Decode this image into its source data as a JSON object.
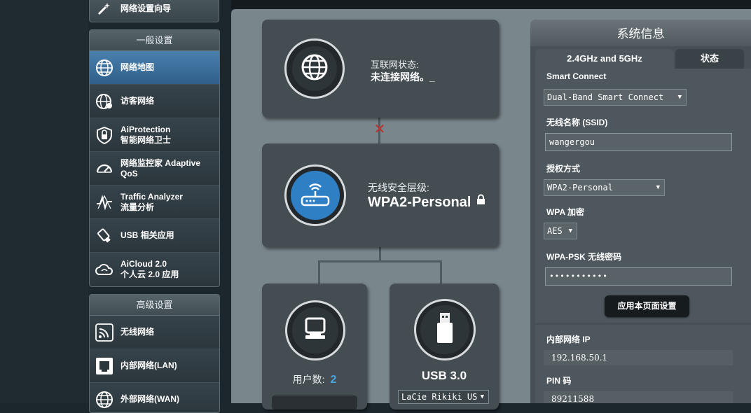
{
  "sidebar": {
    "top_item": {
      "label": "网络设置向导"
    },
    "general": {
      "header": "一般设置",
      "items": [
        {
          "label": "网络地图",
          "icon": "globe-icon",
          "active": true
        },
        {
          "label": "访客网络",
          "icon": "guest-network-icon"
        },
        {
          "label": "AiProtection\n智能网络卫士",
          "icon": "shield-icon"
        },
        {
          "label": "网络监控家 Adaptive\nQoS",
          "icon": "speedometer-icon"
        },
        {
          "label": "Traffic Analyzer\n流量分析",
          "icon": "traffic-analyzer-icon"
        },
        {
          "label": "USB 相关应用",
          "icon": "usb-apps-icon"
        },
        {
          "label": "AiCloud 2.0\n个人云 2.0 应用",
          "icon": "cloud-icon"
        }
      ]
    },
    "advanced": {
      "header": "高级设置",
      "items": [
        {
          "label": "无线网络",
          "icon": "wireless-icon"
        },
        {
          "label": "内部网络(LAN)",
          "icon": "lan-icon"
        },
        {
          "label": "外部网络(WAN)",
          "icon": "wan-globe-icon"
        }
      ]
    }
  },
  "network_map": {
    "internet": {
      "status_label": "互联网状态:",
      "status_value": "未连接网络。_"
    },
    "router": {
      "security_label": "无线安全层级:",
      "security_value": "WPA2-Personal"
    },
    "clients": {
      "label": "用户数:",
      "count": "2"
    },
    "usb": {
      "title": "USB 3.0",
      "device": "LaCie Rikiki US"
    },
    "colors": {
      "disconnected": "#c0312b",
      "accent_blue": "#4aa6e0"
    }
  },
  "system_info": {
    "title": "系统信息",
    "tabs": {
      "active": "2.4GHz and 5GHz",
      "other": "状态"
    },
    "smart_connect": {
      "label": "Smart Connect",
      "value": "Dual-Band Smart Connect"
    },
    "ssid": {
      "label": "无线名称 (SSID)",
      "value": "wangergou"
    },
    "auth": {
      "label": "授权方式",
      "value": "WPA2-Personal"
    },
    "wpa_encryption": {
      "label": "WPA 加密",
      "value": "AES"
    },
    "wpa_psk": {
      "label": "WPA-PSK 无线密码",
      "value": "•••••••••••"
    },
    "apply_button": "应用本页面设置",
    "lan_ip": {
      "label": "内部网络 IP",
      "value": "192.168.50.1"
    },
    "pin": {
      "label": "PIN 码",
      "value": "89211588"
    }
  }
}
